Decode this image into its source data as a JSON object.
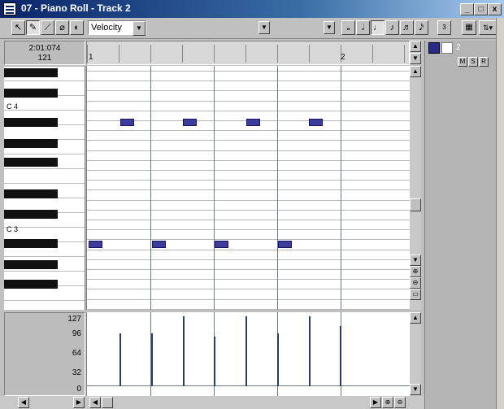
{
  "window": {
    "title": "07 - Piano Roll - Track 2"
  },
  "title_buttons": {
    "minimize": "_",
    "maximize": "□",
    "close": "x"
  },
  "toolbar": {
    "tools": [
      "pointer-tool-icon",
      "pencil-tool-icon",
      "line-tool-icon",
      "eraser-tool-icon",
      "mute-tool-icon"
    ],
    "tool_glyphs": [
      "↖",
      "✎",
      "⟋",
      "⌀",
      "◐"
    ],
    "controller_select": "Velocity",
    "snap_value": "3",
    "note_glyphs": [
      "𝅝",
      "𝅗𝅥",
      "♩",
      "♪",
      "♬",
      "𝅘𝅥𝅯"
    ]
  },
  "info": {
    "time": "2:01:074",
    "value": "121"
  },
  "ruler": {
    "marks": [
      "1",
      "2"
    ]
  },
  "keyboard": {
    "labels": [
      "C 4",
      "C 3"
    ]
  },
  "right_panel": {
    "track_number": "2",
    "buttons": [
      "M",
      "S",
      "R"
    ]
  },
  "velocity": {
    "scale": [
      "127",
      "96",
      "64",
      "32",
      "0"
    ]
  },
  "notes": [
    {
      "beat": 1.0,
      "pitch": "C3",
      "row": 0
    },
    {
      "beat": 2.0,
      "pitch": "C3",
      "row": 0
    },
    {
      "beat": 3.0,
      "pitch": "C3",
      "row": 0
    },
    {
      "beat": 4.0,
      "pitch": "C3",
      "row": 0
    },
    {
      "beat": 1.5,
      "pitch": "A3",
      "row": 1
    },
    {
      "beat": 2.5,
      "pitch": "A3",
      "row": 1
    },
    {
      "beat": 3.5,
      "pitch": "A3",
      "row": 1
    },
    {
      "beat": 4.5,
      "pitch": "A3",
      "row": 1
    }
  ],
  "velocity_values": [
    96,
    96,
    127,
    90,
    127,
    96,
    127,
    110
  ],
  "colors": {
    "note": "#3c3c9c",
    "title_start": "#0a246a",
    "title_end": "#a6caf0"
  }
}
